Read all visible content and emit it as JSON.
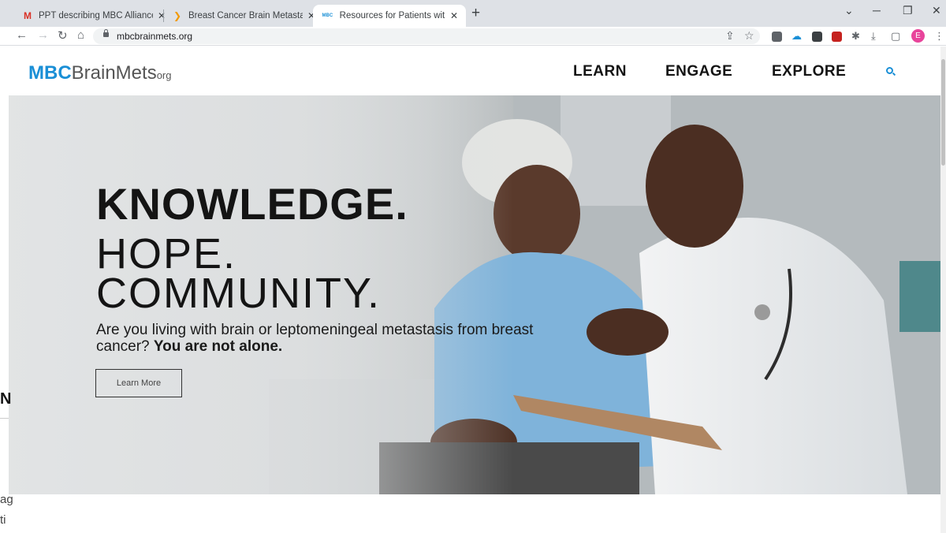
{
  "browser": {
    "tabs": [
      {
        "title": "PPT describing MBC Alliance - Is",
        "favicon": "gmail-icon"
      },
      {
        "title": "Breast Cancer Brain Metastasis In",
        "favicon": "chevron-favicon"
      },
      {
        "title": "Resources for Patients with Brain",
        "favicon": "mbc-favicon",
        "active": true
      }
    ],
    "url": "mbcbrainmets.org",
    "profile_initial": "E",
    "accent_profile": "#e8449b"
  },
  "site": {
    "logo": {
      "mbc": "MBC",
      "brainmets": "BrainMets",
      "org": "org"
    },
    "nav": {
      "learn": "LEARN",
      "engage": "ENGAGE",
      "explore": "EXPLORE"
    },
    "brand_color": "#1a8fd6"
  },
  "hero": {
    "headline_bold": "KNOWLEDGE.",
    "headline_2": "HOPE.",
    "headline_3": "COMMUNITY.",
    "subtext_lead": "Are you living with brain or leptomeningeal metastasis from breast cancer?",
    "subtext_bold": "You are not alone.",
    "cta": "Learn More"
  },
  "bleed": {
    "n": "N",
    "ag": "ag",
    "ti": "ti"
  }
}
